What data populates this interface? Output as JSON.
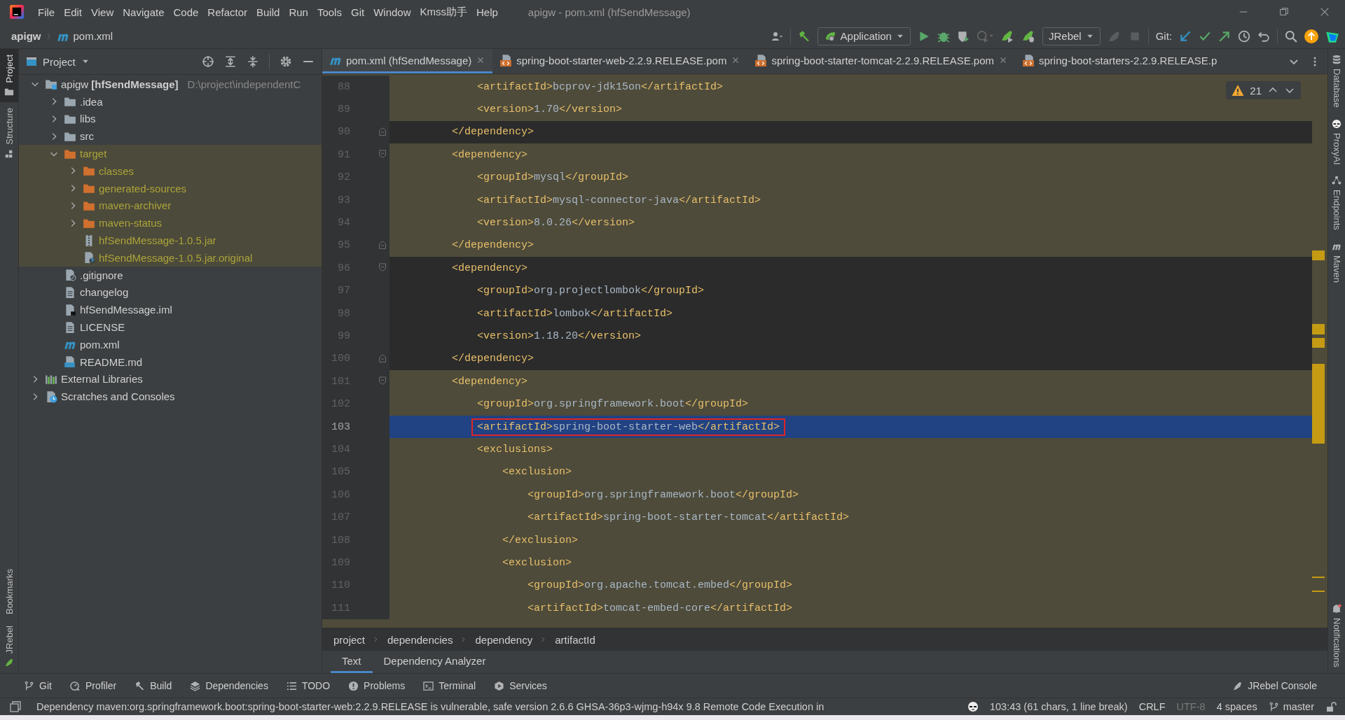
{
  "window": {
    "title": "apigw - pom.xml (hfSendMessage)"
  },
  "menu": [
    "File",
    "Edit",
    "View",
    "Navigate",
    "Code",
    "Refactor",
    "Build",
    "Run",
    "Tools",
    "Git",
    "Window",
    "Kmss助手",
    "Help"
  ],
  "navbar": {
    "project": "apigw",
    "file": "pom.xml",
    "run_config": "Application",
    "jrebel_config": "JRebel",
    "git_label": "Git:"
  },
  "left_stripe": [
    {
      "label": "Project",
      "kind": "project",
      "selected": true
    },
    {
      "label": "Structure",
      "kind": "structure",
      "selected": false
    }
  ],
  "left_stripe_bottom": [
    {
      "label": "Bookmarks",
      "kind": "bookmarks"
    },
    {
      "label": "JRebel",
      "kind": "jrebel"
    }
  ],
  "right_stripe": [
    {
      "label": "Database",
      "kind": "database"
    },
    {
      "label": "ProxyAI",
      "kind": "mask"
    },
    {
      "label": "Endpoints",
      "kind": "endpoints"
    },
    {
      "label": "Maven",
      "kind": "maven"
    }
  ],
  "right_stripe_bottom": [
    {
      "label": "Notifications",
      "kind": "bell"
    }
  ],
  "project_panel": {
    "title": "Project",
    "tree": [
      {
        "label": "apigw **[hfSendMessage]**",
        "location": "D:\\project\\independentC",
        "kind": "module",
        "expanded": true,
        "children": [
          {
            "label": ".idea",
            "kind": "folder",
            "expanded": false,
            "excluded": false
          },
          {
            "label": "libs",
            "kind": "folder",
            "expanded": false,
            "excluded": false
          },
          {
            "label": "src",
            "kind": "folder",
            "expanded": false,
            "excluded": false
          },
          {
            "label": "target",
            "kind": "excluded-folder",
            "expanded": true,
            "excluded": true,
            "children": [
              {
                "label": "classes",
                "kind": "excluded-folder",
                "expanded": false,
                "excluded": true
              },
              {
                "label": "generated-sources",
                "kind": "excluded-folder",
                "expanded": false,
                "excluded": true
              },
              {
                "label": "maven-archiver",
                "kind": "excluded-folder",
                "expanded": false,
                "excluded": true
              },
              {
                "label": "maven-status",
                "kind": "excluded-folder",
                "expanded": false,
                "excluded": true
              },
              {
                "label": "hfSendMessage-1.0.5.jar",
                "kind": "archive",
                "excluded": true
              },
              {
                "label": "hfSendMessage-1.0.5.jar.original",
                "kind": "unknown-file",
                "excluded": true
              }
            ]
          },
          {
            "label": ".gitignore",
            "kind": "ignore-file",
            "excluded": false
          },
          {
            "label": "changelog",
            "kind": "text-file",
            "excluded": false
          },
          {
            "label": "hfSendMessage.iml",
            "kind": "module-file",
            "excluded": false
          },
          {
            "label": "LICENSE",
            "kind": "text-file",
            "excluded": false
          },
          {
            "label": "pom.xml",
            "kind": "pom",
            "excluded": false
          },
          {
            "label": "README.md",
            "kind": "markdown",
            "excluded": false
          }
        ]
      },
      {
        "label": "External Libraries",
        "kind": "libraries",
        "expanded": false
      },
      {
        "label": "Scratches and Consoles",
        "kind": "scratches",
        "expanded": false
      }
    ]
  },
  "editor": {
    "tabs": [
      {
        "label": "pom.xml (hfSendMessage)",
        "kind": "pom",
        "selected": true,
        "closable": true
      },
      {
        "label": "spring-boot-starter-web-2.2.9.RELEASE.pom",
        "kind": "xml",
        "selected": false,
        "closable": true
      },
      {
        "label": "spring-boot-starter-tomcat-2.2.9.RELEASE.pom",
        "kind": "xml",
        "selected": false,
        "closable": true
      },
      {
        "label": "spring-boot-starters-2.2.9.RELEASE.p",
        "kind": "xml",
        "selected": false,
        "closable": false
      }
    ],
    "warnings": "21",
    "lines": [
      {
        "number": "88",
        "text": "            <artifactId>bcprov-jdk15on</artifactId>",
        "highlighted": true,
        "current": false,
        "boxed": false
      },
      {
        "number": "89",
        "text": "            <version>1.70</version>",
        "highlighted": true,
        "current": false,
        "boxed": false
      },
      {
        "number": "90",
        "text": "        </dependency>",
        "highlighted": false,
        "current": false,
        "boxed": false,
        "kind": "fold-end"
      },
      {
        "number": "91",
        "text": "        <dependency>",
        "highlighted": true,
        "current": false,
        "boxed": false,
        "kind": "fold-start"
      },
      {
        "number": "92",
        "text": "            <groupId>mysql</groupId>",
        "highlighted": true,
        "current": false,
        "boxed": false
      },
      {
        "number": "93",
        "text": "            <artifactId>mysql-connector-java</artifactId>",
        "highlighted": true,
        "current": false,
        "boxed": false
      },
      {
        "number": "94",
        "text": "            <version>8.0.26</version>",
        "highlighted": true,
        "current": false,
        "boxed": false
      },
      {
        "number": "95",
        "text": "        </dependency>",
        "highlighted": true,
        "current": false,
        "boxed": false,
        "kind": "fold-end"
      },
      {
        "number": "96",
        "text": "        <dependency>",
        "highlighted": false,
        "current": false,
        "boxed": false,
        "kind": "fold-start"
      },
      {
        "number": "97",
        "text": "            <groupId>org.projectlombok</groupId>",
        "highlighted": false,
        "current": false,
        "boxed": false
      },
      {
        "number": "98",
        "text": "            <artifactId>lombok</artifactId>",
        "highlighted": false,
        "current": false,
        "boxed": false
      },
      {
        "number": "99",
        "text": "            <version>1.18.20</version>",
        "highlighted": false,
        "current": false,
        "boxed": false
      },
      {
        "number": "100",
        "text": "        </dependency>",
        "highlighted": false,
        "current": false,
        "boxed": false,
        "kind": "fold-end"
      },
      {
        "number": "101",
        "text": "        <dependency>",
        "highlighted": true,
        "current": false,
        "boxed": false,
        "kind": "fold-start"
      },
      {
        "number": "102",
        "text": "            <groupId>org.springframework.boot</groupId>",
        "highlighted": true,
        "current": false,
        "boxed": false
      },
      {
        "number": "103",
        "text": "            <artifactId>spring-boot-starter-web</artifactId>",
        "highlighted": true,
        "current": true,
        "boxed": true
      },
      {
        "number": "104",
        "text": "            <exclusions>",
        "highlighted": true,
        "current": false,
        "boxed": false
      },
      {
        "number": "105",
        "text": "                <exclusion>",
        "highlighted": true,
        "current": false,
        "boxed": false
      },
      {
        "number": "106",
        "text": "                    <groupId>org.springframework.boot</groupId>",
        "highlighted": true,
        "current": false,
        "boxed": false
      },
      {
        "number": "107",
        "text": "                    <artifactId>spring-boot-starter-tomcat</artifactId>",
        "highlighted": true,
        "current": false,
        "boxed": false
      },
      {
        "number": "108",
        "text": "                </exclusion>",
        "highlighted": true,
        "current": false,
        "boxed": false
      },
      {
        "number": "109",
        "text": "                <exclusion>",
        "highlighted": true,
        "current": false,
        "boxed": false
      },
      {
        "number": "110",
        "text": "                    <groupId>org.apache.tomcat.embed</groupId>",
        "highlighted": true,
        "current": false,
        "boxed": false
      },
      {
        "number": "111",
        "text": "                    <artifactId>tomcat-embed-core</artifactId>",
        "highlighted": true,
        "current": false,
        "boxed": false
      }
    ],
    "breadcrumbs": [
      "project",
      "dependencies",
      "dependency",
      "artifactId"
    ],
    "bottom_tabs": [
      {
        "label": "Text",
        "selected": true
      },
      {
        "label": "Dependency Analyzer",
        "selected": false
      }
    ]
  },
  "tool_windows": [
    {
      "label": "Git",
      "kind": "git"
    },
    {
      "label": "Profiler",
      "kind": "profiler"
    },
    {
      "label": "Build",
      "kind": "build"
    },
    {
      "label": "Dependencies",
      "kind": "dependencies"
    },
    {
      "label": "TODO",
      "kind": "todo"
    },
    {
      "label": "Problems",
      "kind": "problems"
    },
    {
      "label": "Terminal",
      "kind": "terminal"
    },
    {
      "label": "Services",
      "kind": "services"
    }
  ],
  "tool_windows_right": [
    {
      "label": "JRebel Console",
      "kind": "jrebel"
    }
  ],
  "status_bar": {
    "message": "Dependency maven:org.springframework.boot:spring-boot-starter-web:2.2.9.RELEASE is vulnerable, safe version 2.6.6 GHSA-36p3-wjmg-h94x 9.8 Remote Code Execution in",
    "items": [
      {
        "label": "103:43 (61 chars, 1 line break)",
        "disabled": false
      },
      {
        "label": "CRLF",
        "disabled": false
      },
      {
        "label": "UTF-8",
        "disabled": true
      },
      {
        "label": "4 spaces",
        "disabled": false
      }
    ],
    "branch": "master"
  }
}
